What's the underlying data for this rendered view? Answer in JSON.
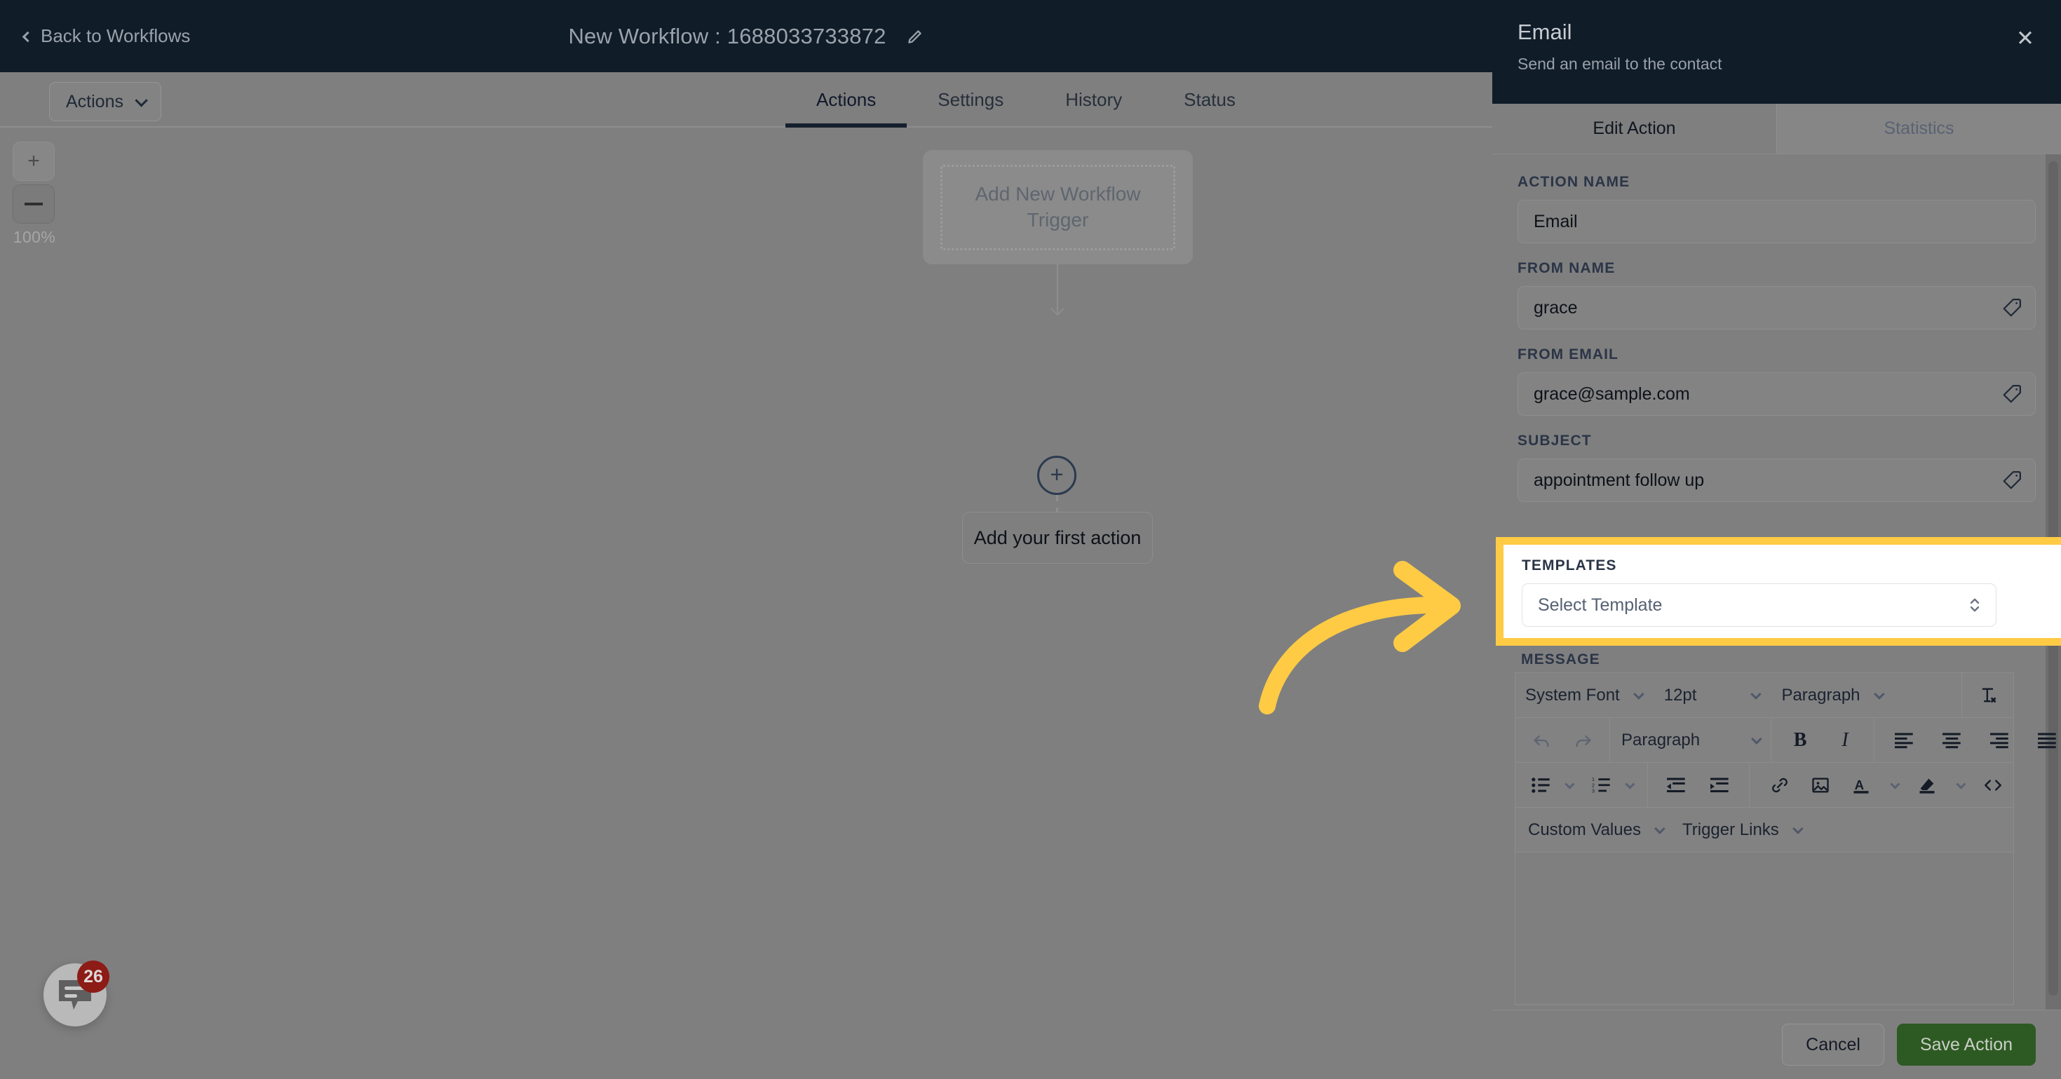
{
  "topbar": {
    "back_label": "Back to Workflows",
    "back_icon": "chevron-left-icon",
    "workflow_title": "New Workflow : 1688033733872",
    "edit_icon": "pencil-icon"
  },
  "tabstrip": {
    "actions_dropdown_label": "Actions",
    "actions_dropdown_icon": "chevron-down-icon",
    "tabs": [
      {
        "label": "Actions",
        "active": true
      },
      {
        "label": "Settings",
        "active": false
      },
      {
        "label": "History",
        "active": false
      },
      {
        "label": "Status",
        "active": false
      }
    ]
  },
  "canvas": {
    "zoom": {
      "zoom_in_label": "+",
      "zoom_in_icon": "plus-icon",
      "zoom_out_label": "—",
      "zoom_out_icon": "minus-icon",
      "level": "100%"
    },
    "trigger_card_label": "Add New Workflow Trigger",
    "add_node_icon": "plus-circle-icon",
    "first_action_label": "Add your first action"
  },
  "chat_widget": {
    "icon": "chat-bubble-icon",
    "badge_count": "26",
    "badge_color": "#8d1b16"
  },
  "panel": {
    "title": "Email",
    "subtitle": "Send an email to the contact",
    "close_icon": "close-icon",
    "tabs": [
      {
        "label": "Edit Action",
        "active": true
      },
      {
        "label": "Statistics",
        "active": false
      }
    ],
    "fields": [
      {
        "label": "ACTION NAME",
        "value": "Email",
        "placeholder": "Action Name",
        "has_tag_icon": false
      },
      {
        "label": "FROM NAME",
        "value": "grace",
        "placeholder": "From Name",
        "has_tag_icon": true
      },
      {
        "label": "FROM EMAIL",
        "value": "grace@sample.com",
        "placeholder": "From Email",
        "has_tag_icon": true
      },
      {
        "label": "SUBJECT",
        "value": "appointment follow up",
        "placeholder": "Subject",
        "has_tag_icon": true
      }
    ],
    "templates": {
      "label": "TEMPLATES",
      "select_value": "Select Template",
      "select_icon": "up-down-chevron-icon",
      "highlight_color": "#ffcb45",
      "highlighted": true
    },
    "message": {
      "label": "MESSAGE",
      "toolbar_row1": {
        "font_family": "System Font",
        "font_size": "12pt",
        "block_format": "Paragraph",
        "clear_format_icon": "clear-formatting-icon"
      },
      "toolbar_row2": {
        "undo_icon": "undo-icon",
        "redo_icon": "redo-icon",
        "block_format": "Paragraph",
        "bold_label": "B",
        "italic_label": "I",
        "align_left_icon": "align-left-icon",
        "align_center_icon": "align-center-icon",
        "align_right_icon": "align-right-icon",
        "align_justify_icon": "align-justify-icon"
      },
      "toolbar_row3": {
        "bullet_list_icon": "bullet-list-icon",
        "numbered_list_icon": "numbered-list-icon",
        "outdent_icon": "outdent-icon",
        "indent_icon": "indent-icon",
        "link_icon": "link-icon",
        "image_icon": "image-icon",
        "text_color_icon": "text-color-icon",
        "highlight_color_icon": "highlight-color-icon",
        "source_code_icon": "source-code-icon"
      },
      "toolbar_row4": {
        "custom_values_label": "Custom Values",
        "trigger_links_label": "Trigger Links"
      },
      "body_value": ""
    },
    "footer": {
      "cancel_label": "Cancel",
      "save_label": "Save Action",
      "save_color": "#2d5a22"
    }
  },
  "annotation": {
    "arrow_icon": "curved-arrow-right-icon",
    "arrow_color": "#ffcb45"
  }
}
